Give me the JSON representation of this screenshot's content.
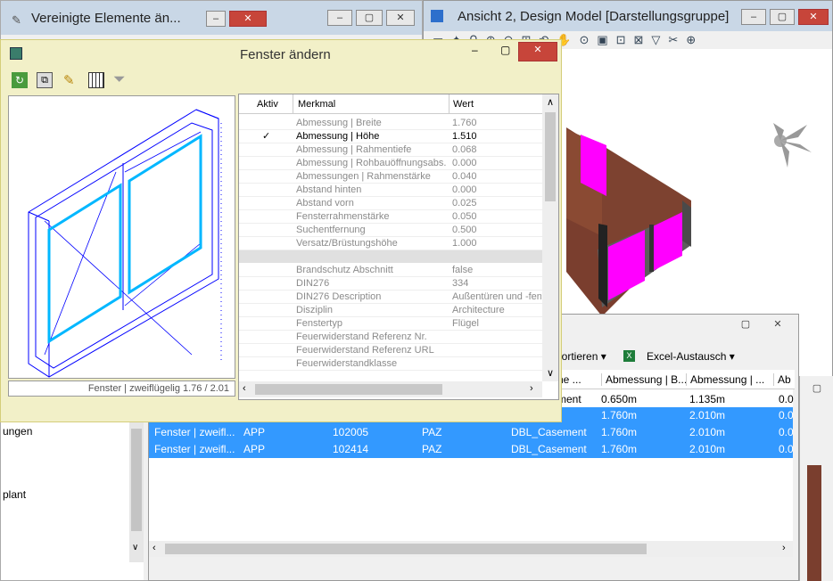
{
  "bg_window_left": {
    "title": "Vereinigte Elemente än..."
  },
  "bg_window_right": {
    "title": "Ansicht 2, Design Model [Darstellungsgruppe]"
  },
  "tree_labels": [
    "ungen",
    "plant"
  ],
  "dialog": {
    "title": "Fenster ändern",
    "preview_caption": "Fenster | zweiflügelig  1.76 / 2.01",
    "columns": {
      "aktiv": "Aktiv",
      "merkmal": "Merkmal",
      "wert": "Wert"
    },
    "props_group1": [
      {
        "check": "",
        "name": "Abmessung | Breite",
        "value": "1.760"
      },
      {
        "check": "✓",
        "name": "Abmessung | Höhe",
        "value": "1.510"
      },
      {
        "check": "",
        "name": "Abmessung | Rahmentiefe",
        "value": "0.068"
      },
      {
        "check": "",
        "name": "Abmessung | Rohbauöffnungsabs...",
        "value": "0.000"
      },
      {
        "check": "",
        "name": "Abmessungen | Rahmenstärke",
        "value": "0.040"
      },
      {
        "check": "",
        "name": "Abstand hinten",
        "value": "0.000"
      },
      {
        "check": "",
        "name": "Abstand vorn",
        "value": "0.025"
      },
      {
        "check": "",
        "name": "Fensterrahmenstärke",
        "value": "0.050"
      },
      {
        "check": "",
        "name": "Suchentfernung",
        "value": "0.500"
      },
      {
        "check": "",
        "name": "Versatz/Brüstungshöhe",
        "value": "1.000"
      }
    ],
    "props_group2": [
      {
        "name": "Brandschutz Abschnitt",
        "value": "false"
      },
      {
        "name": "DIN276",
        "value": "334"
      },
      {
        "name": "DIN276 Description",
        "value": "Außentüren und -fenster"
      },
      {
        "name": "Disziplin",
        "value": "Architecture"
      },
      {
        "name": "Fenstertyp",
        "value": "Flügel"
      },
      {
        "name": "Feuerwiderstand Referenz Nr.",
        "value": ""
      },
      {
        "name": "Feuerwiderstand Referenz URL",
        "value": ""
      },
      {
        "name": "Feuerwiderstandklasse",
        "value": ""
      }
    ]
  },
  "table_window": {
    "toolbar": {
      "export_label": "xportieren",
      "excel_label": "Excel-Austausch"
    },
    "headers": [
      "he ...",
      "Abmessung | B...",
      "Abmessung | ...",
      "Ab"
    ],
    "top_row": {
      "c0": "ment",
      "c1": "0.650m",
      "c2": "1.135m",
      "c3": "0.0"
    },
    "rows": [
      {
        "name": "",
        "app": "",
        "id": "",
        "paz": "",
        "type": "ment",
        "w": "1.760m",
        "h": "2.010m",
        "x": "0.0"
      },
      {
        "name": "Fenster | zweifl...",
        "app": "APP",
        "id": "102005",
        "paz": "PAZ",
        "type": "DBL_Casement",
        "w": "1.760m",
        "h": "2.010m",
        "x": "0.0"
      },
      {
        "name": "Fenster | zweifl...",
        "app": "APP",
        "id": "102414",
        "paz": "PAZ",
        "type": "DBL_Casement",
        "w": "1.760m",
        "h": "2.010m",
        "x": "0.0"
      }
    ]
  }
}
